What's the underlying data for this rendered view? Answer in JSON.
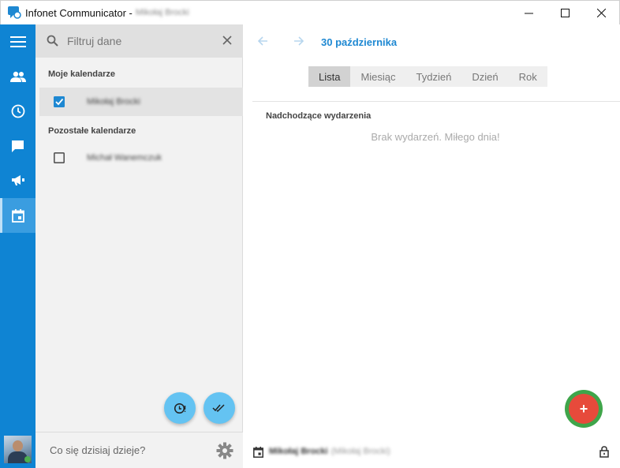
{
  "window": {
    "title": "Infonet Communicator -",
    "title_user": "Mikołaj Brocki",
    "controls": [
      "minimize-icon",
      "maximize-icon",
      "close-icon"
    ]
  },
  "rail": {
    "items": [
      {
        "name": "menu",
        "icon": "hamburger-icon"
      },
      {
        "name": "contacts",
        "icon": "people-icon"
      },
      {
        "name": "history",
        "icon": "clock-icon"
      },
      {
        "name": "messages",
        "icon": "chat-icon"
      },
      {
        "name": "announcements",
        "icon": "megaphone-icon"
      },
      {
        "name": "calendar",
        "icon": "calendar-icon",
        "active": true
      }
    ],
    "accent": "#0f84d3"
  },
  "panel": {
    "search": {
      "placeholder": "Filtruj dane"
    },
    "my_calendars_title": "Moje kalendarze",
    "my_calendars": [
      {
        "name": "Mikołaj Brocki",
        "checked": true
      }
    ],
    "other_calendars_title": "Pozostałe kalendarze",
    "other_calendars": [
      {
        "name": "Michał Wanemczuk",
        "checked": false
      }
    ],
    "status": {
      "placeholder": "Co się dzisiaj dzieje?"
    }
  },
  "main": {
    "date_title": "30 października",
    "tabs": [
      {
        "label": "Lista",
        "active": true
      },
      {
        "label": "Miesiąc",
        "active": false
      },
      {
        "label": "Tydzień",
        "active": false
      },
      {
        "label": "Dzień",
        "active": false
      },
      {
        "label": "Rok",
        "active": false
      }
    ],
    "upcoming_title": "Nadchodzące wydarzenia",
    "empty_message": "Brak wydarzeń. Miłego dnia!",
    "add_label": "+",
    "footer": {
      "user_name": "Mikołaj Brocki",
      "user_detail": "(Mikołaj Brocki)"
    }
  },
  "colors": {
    "accent": "#1e88d2",
    "fab_small": "#64c3f2",
    "fab_add": "#e74a3b",
    "fab_ring": "#3fa54a"
  }
}
